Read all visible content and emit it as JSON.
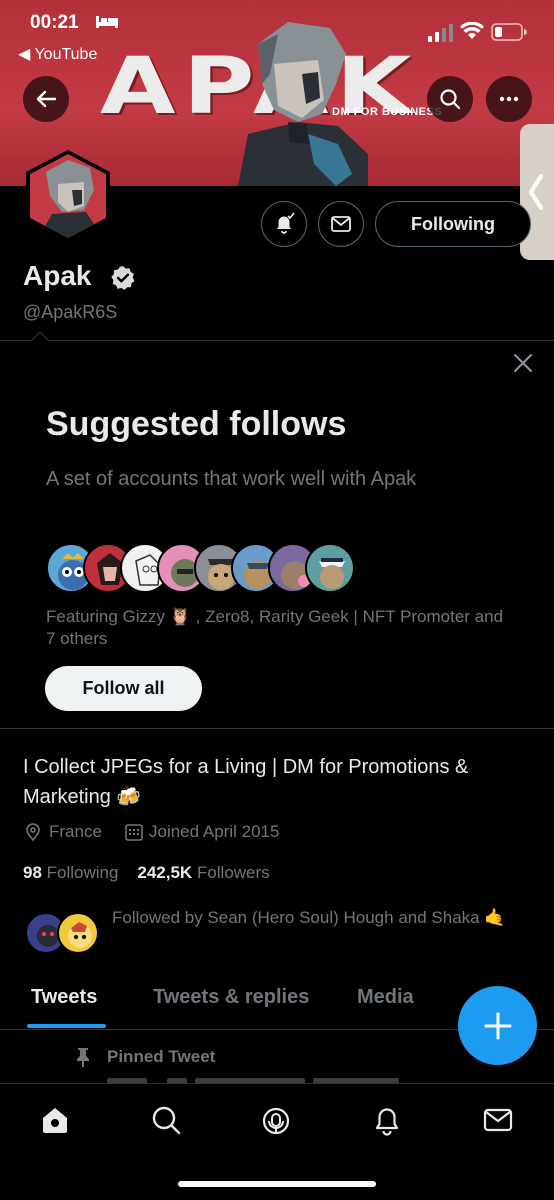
{
  "status_bar": {
    "time": "00:21",
    "back_app": "◀ YouTube"
  },
  "banner": {
    "logo_text": "APAK",
    "logo_subtitle": "DM FOR BUSINESS",
    "banner_color": "#b3303a"
  },
  "profile": {
    "name": "Apak",
    "handle": "@ApakR6S",
    "following_button": "Following",
    "bio": "I Collect JPEGs for a Living | DM for Promotions & Marketing 🍻",
    "location": "France",
    "joined": "Joined April 2015",
    "following_count": "98",
    "following_label": "Following",
    "followers_count": "242,5K",
    "followers_label": "Followers",
    "followed_by": "Followed by Sean (Hero Soul) Hough and Shaka 🤙"
  },
  "suggested": {
    "title": "Suggested follows",
    "subtitle": "A set of accounts that work well with Apak",
    "featuring": "Featuring Gizzy 🦉 , Zero8, Rarity Geek | NFT Promoter and 7 others",
    "follow_all": "Follow all"
  },
  "tabs": [
    {
      "label": "Tweets",
      "active": true
    },
    {
      "label": "Tweets & replies",
      "active": false
    },
    {
      "label": "Media",
      "active": false
    }
  ],
  "pinned": {
    "label": "Pinned Tweet"
  },
  "colors": {
    "accent": "#1d9bf0",
    "background": "#000000",
    "muted_text": "#71767b"
  },
  "bottom_nav": [
    "home-icon",
    "search-icon",
    "spaces-icon",
    "notifications-icon",
    "messages-icon"
  ]
}
